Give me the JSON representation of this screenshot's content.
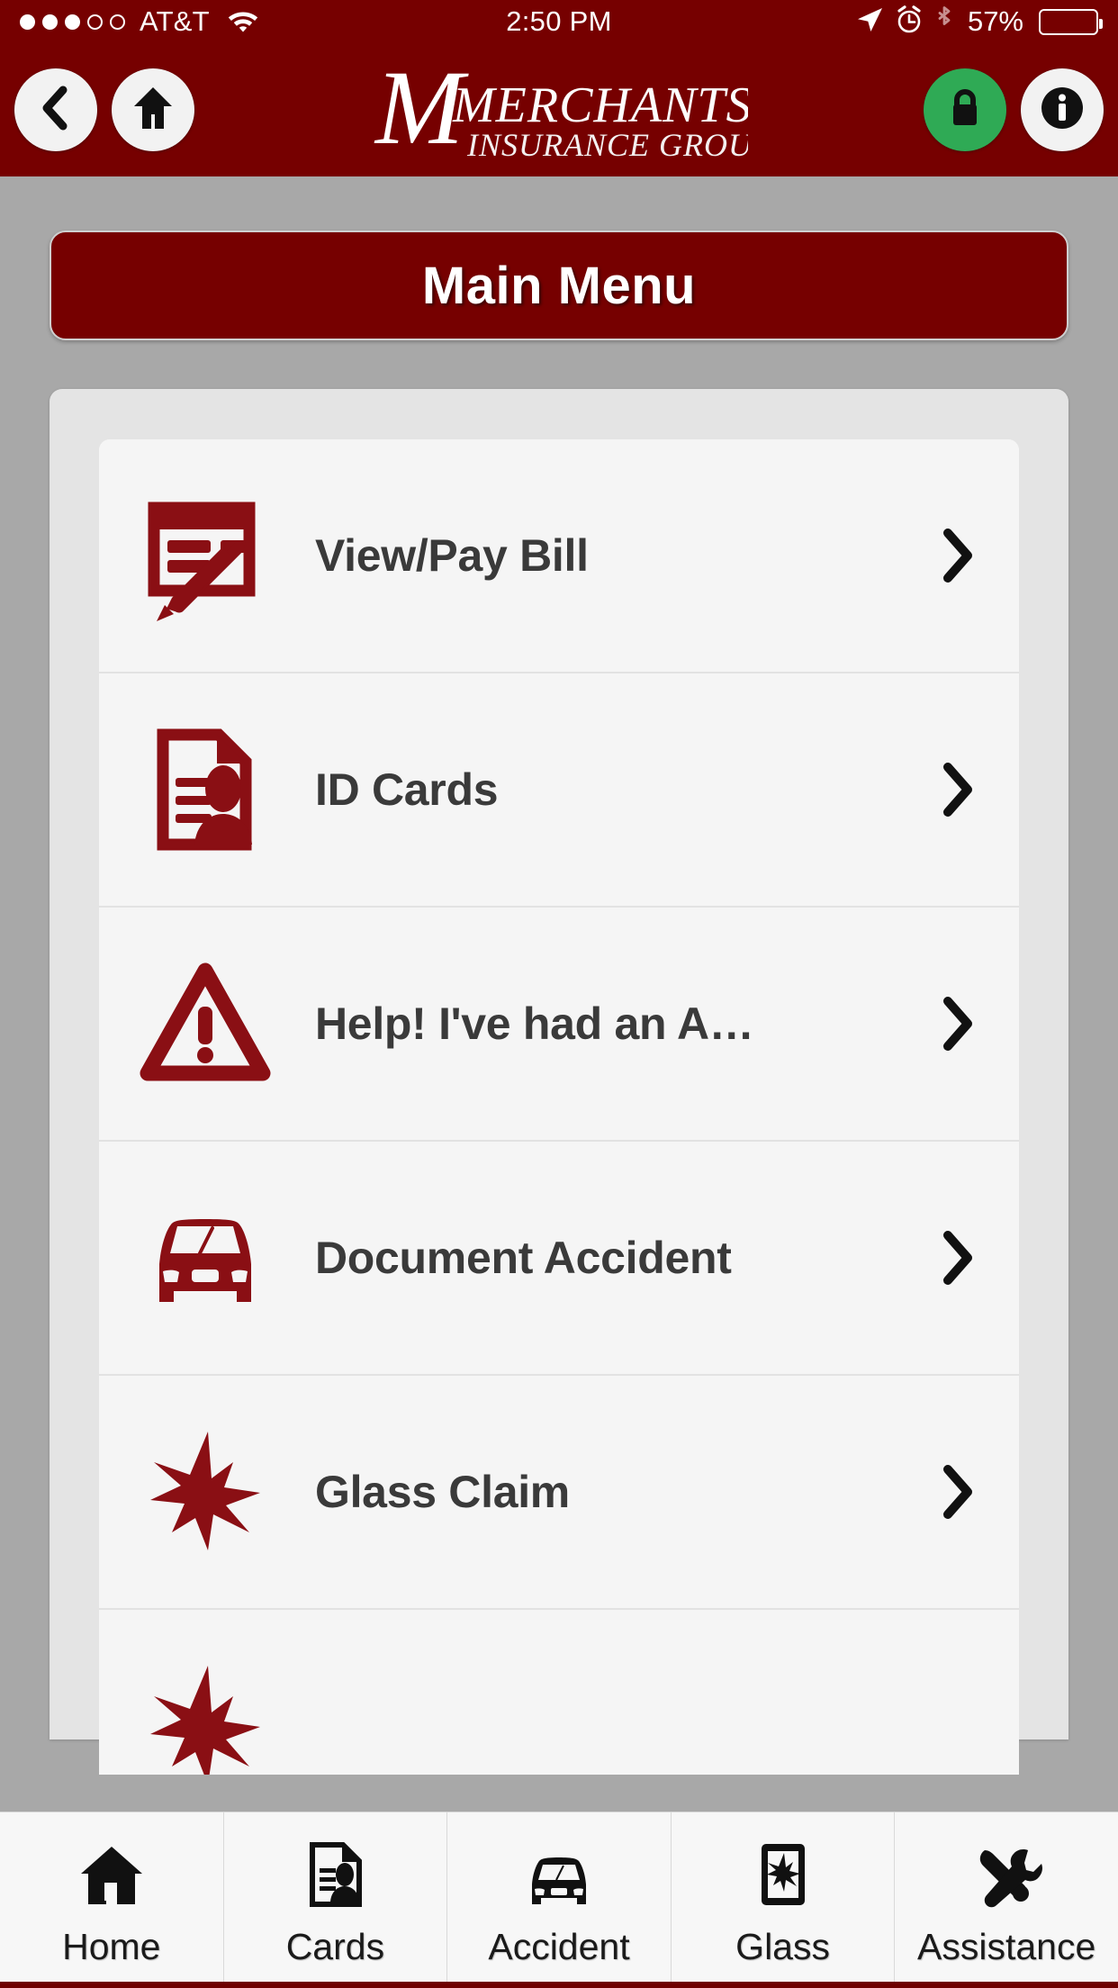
{
  "status_bar": {
    "signal_dots_filled": 3,
    "signal_dots_total": 5,
    "carrier": "AT&T",
    "wifi_icon": "wifi-icon",
    "time": "2:50 PM",
    "location_icon": "location-arrow-icon",
    "alarm_icon": "alarm-clock-icon",
    "bluetooth_icon": "bluetooth-icon",
    "battery_percent": "57%",
    "battery_fill_ratio": 0.57
  },
  "nav_bar": {
    "back_icon": "chevron-left-icon",
    "home_icon": "home-icon",
    "lock_icon": "lock-icon",
    "info_icon": "info-icon",
    "lock_badge_color": "#2faa55",
    "logo": {
      "monogram": "M",
      "line1": "MERCHANTS",
      "line2": "INSURANCE GROUP"
    }
  },
  "theme": {
    "brand_red": "#760000",
    "icon_red": "#8a0f14",
    "page_bg": "#a8a8a8",
    "panel_bg": "#e4e4e4",
    "row_bg": "#f5f5f5"
  },
  "main": {
    "banner_title": "Main Menu",
    "menu_items": [
      {
        "label": "View/Pay Bill",
        "icon": "bill-pen-icon",
        "chevron": "chevron-right-icon"
      },
      {
        "label": "ID Cards",
        "icon": "id-card-icon",
        "chevron": "chevron-right-icon"
      },
      {
        "label": "Help! I've had an A…",
        "icon": "warning-triangle-icon",
        "chevron": "chevron-right-icon"
      },
      {
        "label": "Document Accident",
        "icon": "car-front-icon",
        "chevron": "chevron-right-icon"
      },
      {
        "label": "Glass Claim",
        "icon": "glass-burst-icon",
        "chevron": "chevron-right-icon"
      }
    ]
  },
  "tab_bar": {
    "tabs": [
      {
        "label": "Home",
        "icon": "home-icon"
      },
      {
        "label": "Cards",
        "icon": "id-card-icon"
      },
      {
        "label": "Accident",
        "icon": "car-front-icon"
      },
      {
        "label": "Glass",
        "icon": "phone-glass-burst-icon"
      },
      {
        "label": "Assistance",
        "icon": "tools-icon"
      }
    ]
  }
}
